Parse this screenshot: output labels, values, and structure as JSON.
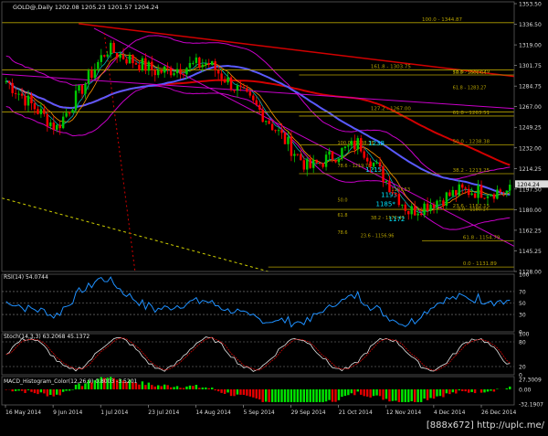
{
  "main": {
    "title": "GOLD@,Daily 1202.08 1205.23 1201.57 1204.24",
    "ymin": 1128.0,
    "ymax": 1353.5,
    "y_ticks": [
      "1353.50",
      "1336.50",
      "1319.00",
      "1301.75",
      "1284.75",
      "1267.00",
      "1249.25",
      "1232.00",
      "1214.25",
      "1197.50",
      "1180.00",
      "1162.25",
      "1145.25",
      "1128.00"
    ],
    "price_tag": "1204.24",
    "fib_levels": [
      {
        "price": 1344.87,
        "label": "100.0 - 1344.87",
        "x1": 0.0,
        "x2": 1.0,
        "lx": 0.82
      },
      {
        "price": 1303.75,
        "label": "161.8 - 1303.75",
        "x1": 0.0,
        "x2": 1.0,
        "lx": 0.72
      },
      {
        "price": 1299.29,
        "label": "78.6 - 1299.29",
        "x1": 0.58,
        "x2": 1.0,
        "lx": 0.88
      },
      {
        "price": 1267.0,
        "label": "127.2 - 1267.00",
        "x1": 0.0,
        "x2": 1.0,
        "lx": 0.72
      },
      {
        "price": 1263.51,
        "label": "61.8 - 1263.51",
        "x1": 0.58,
        "x2": 1.0,
        "lx": 0.88
      },
      {
        "price": 1238.38,
        "label": "50.0 - 1238.38",
        "x1": 0.58,
        "x2": 1.0,
        "lx": 0.88
      },
      {
        "price": 1213.25,
        "label": "38.2 - 1213.25",
        "x1": 0.58,
        "x2": 1.0,
        "lx": 0.88
      },
      {
        "price": 1182.15,
        "label": "23.6 - 1182.15",
        "x1": 0.58,
        "x2": 1.0,
        "lx": 0.88
      },
      {
        "price": 1154.79,
        "label": "61.8 - 1154.79",
        "x1": 0.82,
        "x2": 1.0,
        "lx": 0.9
      },
      {
        "price": 1131.89,
        "label": "0.0 - 1131.89",
        "x1": 0.52,
        "x2": 1.0,
        "lx": 0.9
      }
    ],
    "fib_side": [
      {
        "price": 1238.0,
        "label": "100.0 - 1238.38",
        "x": 0.655
      },
      {
        "price": 1218.0,
        "label": "78.6 - 1219.78",
        "x": 0.655
      },
      {
        "price": 1197.5,
        "label": "1197.53",
        "x": 0.76
      },
      {
        "price": 1180.14,
        "label": "0.0 - 1180.14",
        "x": 0.89
      },
      {
        "price": 1172.47,
        "label": "38.2 - 1172.47",
        "x": 0.72
      },
      {
        "price": 1156.96,
        "label": "23.6 - 1156.96",
        "x": 0.7
      },
      {
        "price": 1160.0,
        "label": "78.6",
        "x": 0.655
      },
      {
        "price": 1188.0,
        "label": "50.0",
        "x": 0.655
      },
      {
        "price": 1175.0,
        "label": "61.8",
        "x": 0.655
      },
      {
        "price": 1299.29,
        "label": "50.0 - 1301.04",
        "x": 0.88
      },
      {
        "price": 1286.0,
        "label": "61.8 - 1283.27",
        "x": 0.88
      }
    ],
    "cyan_labels": [
      {
        "price": 1238.0,
        "label": "1238",
        "x": 0.715
      },
      {
        "price": 1215.0,
        "label": "1215*",
        "x": 0.71
      },
      {
        "price": 1193.0,
        "label": "1193",
        "x": 0.74
      },
      {
        "price": 1185.0,
        "label": "1185*",
        "x": 0.73
      },
      {
        "price": 1172.0,
        "label": "1172",
        "x": 0.755
      }
    ]
  },
  "rsi": {
    "label": "RSI(14) 54.0744",
    "ticks": [
      "100",
      "70",
      "50",
      "30",
      "0"
    ]
  },
  "stoch": {
    "label": "Stoch(14,3,3) 63.2068 45.1372",
    "ticks": [
      "100",
      "80",
      "20",
      "0"
    ]
  },
  "macd": {
    "label": "MACD_Histogram_Color(12,26,9) 0.8003 -3.5201",
    "ticks": [
      "27.3009",
      "0.00",
      "-32.1907"
    ]
  },
  "time_axis": [
    "16 May 2014",
    "9 Jun 2014",
    "1 Jul 2014",
    "23 Jul 2014",
    "14 Aug 2014",
    "5 Sep 2014",
    "29 Sep 2014",
    "21 Oct 2014",
    "12 Nov 2014",
    "4 Dec 2014",
    "26 Dec 2014"
  ],
  "watermark": "[888x672] http://uplc.me/",
  "colors": {
    "bull": "#00c800",
    "bear": "#ff0000",
    "fib": "#b4a000",
    "ma_blue": "#5a5aff",
    "ma_red": "#d20000",
    "band": "#c800c8",
    "cyan": "#00e6ff",
    "grid": "#5a5a5a"
  },
  "chart_data": {
    "type": "line",
    "title": "GOLD@,Daily 1202.08 1205.23 1201.57 1204.24",
    "xlabel": "",
    "ylabel": "",
    "ylim": [
      1128.0,
      1353.5
    ],
    "categories": [
      "16 May 2014",
      "9 Jun 2014",
      "1 Jul 2014",
      "23 Jul 2014",
      "14 Aug 2014",
      "5 Sep 2014",
      "29 Sep 2014",
      "21 Oct 2014",
      "12 Nov 2014",
      "4 Dec 2014",
      "26 Dec 2014"
    ],
    "series": [
      {
        "values": [
          1294,
          1253,
          1322,
          1302,
          1310,
          1270,
          1218,
          1240,
          1180,
          1198,
          1198
        ]
      }
    ]
  }
}
